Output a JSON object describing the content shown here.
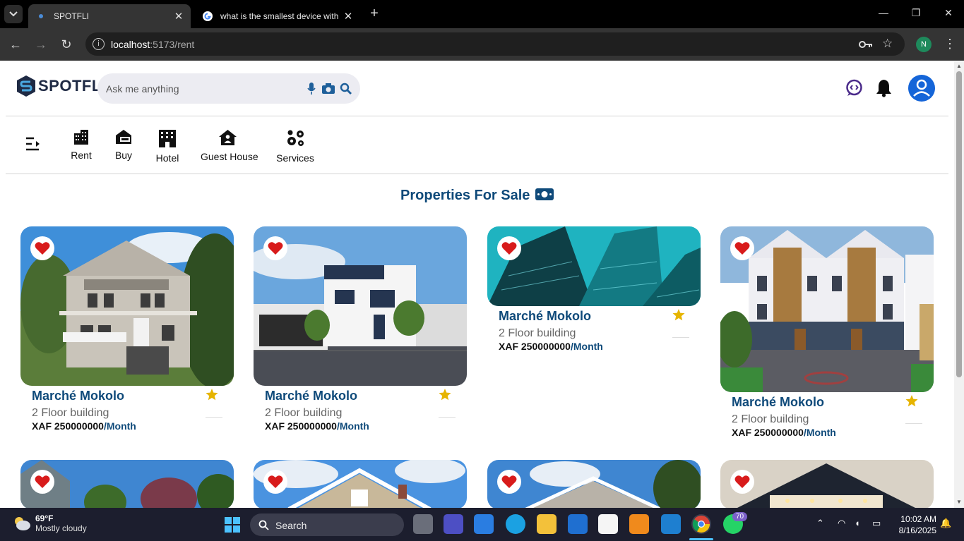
{
  "browser": {
    "tabs": [
      {
        "title": "SPOTFLI",
        "active": true
      },
      {
        "title": "what is the smallest device with",
        "active": false
      }
    ],
    "url_host": "localhost",
    "url_path": ":5173/rent",
    "profile_initial": "N"
  },
  "header": {
    "logo_text": "SPOTFLI",
    "search_placeholder": "Ask me anything"
  },
  "categories": [
    {
      "label": "Rent",
      "icon": "building-icon"
    },
    {
      "label": "Buy",
      "icon": "house-money-icon"
    },
    {
      "label": "Hotel",
      "icon": "hotel-icon"
    },
    {
      "label": "Guest House",
      "icon": "guest-house-icon"
    },
    {
      "label": "Services",
      "icon": "gears-icon"
    }
  ],
  "section_title": "Properties For Sale",
  "listings": [
    {
      "name": "Marché Mokolo",
      "desc": "2 Floor building",
      "price": "XAF 250000000",
      "period": "/Month"
    },
    {
      "name": "Marché Mokolo",
      "desc": "2 Floor building",
      "price": "XAF 250000000",
      "period": "/Month"
    },
    {
      "name": "Marché Mokolo",
      "desc": "2 Floor building",
      "price": "XAF 250000000",
      "period": "/Month"
    },
    {
      "name": "Marché Mokolo",
      "desc": "2 Floor building",
      "price": "XAF 250000000",
      "period": "/Month"
    }
  ],
  "taskbar": {
    "weather_temp": "69°F",
    "weather_desc": "Mostly cloudy",
    "search_label": "Search",
    "whatsapp_badge": "70",
    "time": "10:02 AM",
    "date": "8/16/2025"
  },
  "colors": {
    "brand": "#0f4a7a",
    "heart": "#d81b1b",
    "star": "#e6b400",
    "profile": "#1565d8"
  }
}
